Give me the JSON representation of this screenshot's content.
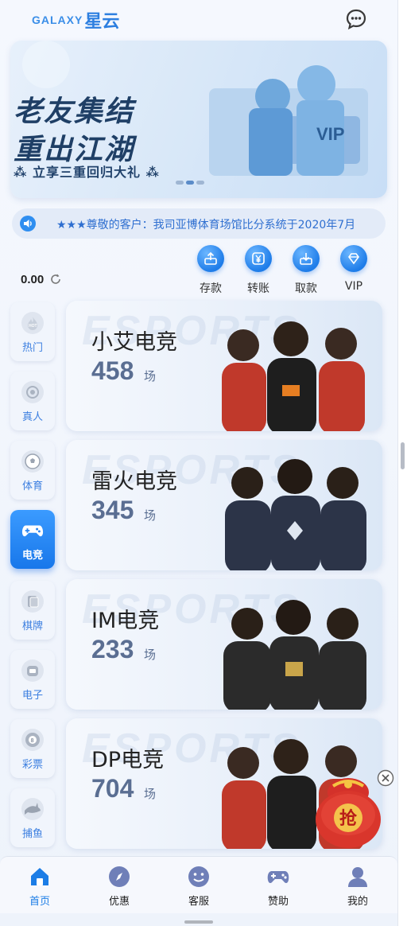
{
  "header": {
    "logo_en": "GALAXY",
    "logo_cn": "星云",
    "chat_icon": "chat-bubble-icon"
  },
  "banner": {
    "line1": "老友集结",
    "line2": "重出江湖",
    "line3": "⁂ 立享三重回归大礼 ⁂",
    "slides_total": 3,
    "active_slide": 1
  },
  "notice": {
    "icon": "speaker-icon",
    "text": "★★★尊敬的客户：我司亚博体育场馆比分系统于2020年7月"
  },
  "wallet": {
    "balance": "0.00",
    "refresh_icon": "refresh-icon"
  },
  "actions": [
    {
      "label": "存款",
      "icon": "deposit-icon"
    },
    {
      "label": "转账",
      "icon": "transfer-yen-icon"
    },
    {
      "label": "取款",
      "icon": "withdraw-icon"
    },
    {
      "label": "VIP",
      "icon": "vip-diamond-icon"
    }
  ],
  "sidebar": {
    "items": [
      {
        "label": "热门",
        "icon": "hot-flame-icon"
      },
      {
        "label": "真人",
        "icon": "live-casino-icon"
      },
      {
        "label": "体育",
        "icon": "soccer-ball-icon"
      },
      {
        "label": "电竞",
        "icon": "gamepad-icon"
      },
      {
        "label": "棋牌",
        "icon": "cards-icon"
      },
      {
        "label": "电子",
        "icon": "slot-machine-icon"
      },
      {
        "label": "彩票",
        "icon": "lottery-ball-icon"
      },
      {
        "label": "捕鱼",
        "icon": "shark-icon"
      }
    ],
    "active_index": 3
  },
  "games": [
    {
      "title": "小艾电竞",
      "count": "458",
      "unit": "场",
      "team_color": "#c0392b"
    },
    {
      "title": "雷火电竞",
      "count": "345",
      "unit": "场",
      "team_color": "#2c3448"
    },
    {
      "title": "IM电竞",
      "count": "233",
      "unit": "场",
      "team_color": "#2b2b2b"
    },
    {
      "title": "DP电竞",
      "count": "704",
      "unit": "场",
      "team_color": "#c0392b"
    }
  ],
  "card_watermark": "ESPORTS",
  "red_envelope": {
    "label": "抢",
    "close_icon": "close-circle-icon"
  },
  "bottom_nav": {
    "items": [
      {
        "label": "首页",
        "icon": "home-icon"
      },
      {
        "label": "优惠",
        "icon": "compass-icon"
      },
      {
        "label": "客服",
        "icon": "support-smile-icon"
      },
      {
        "label": "赞助",
        "icon": "sponsor-gamepad-icon"
      },
      {
        "label": "我的",
        "icon": "user-icon"
      }
    ],
    "active_index": 0
  },
  "colors": {
    "accent": "#1c7de6",
    "notice_text": "#2f6fd0",
    "count_text": "#5a6e92"
  }
}
